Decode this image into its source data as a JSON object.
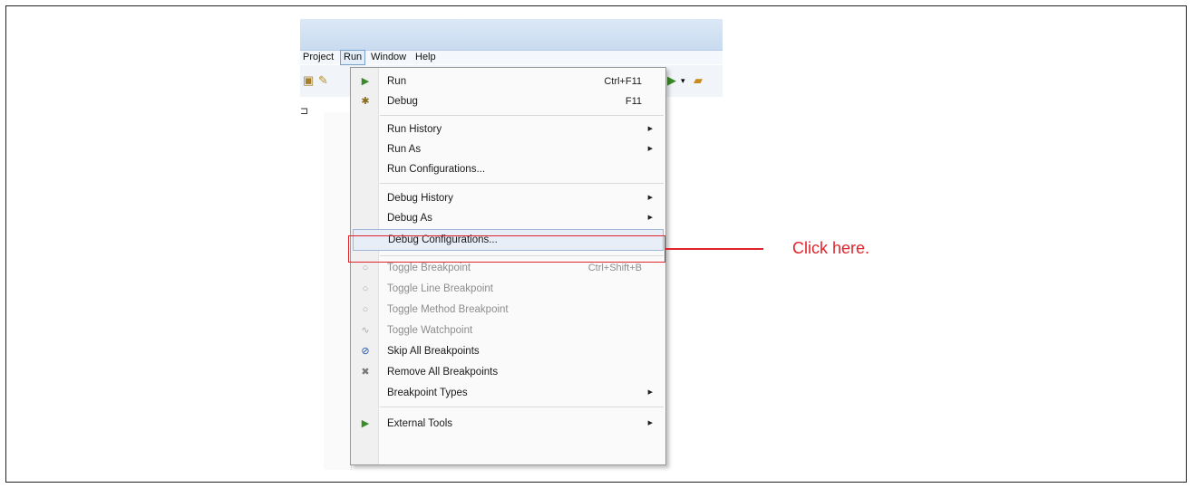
{
  "menubar": [
    {
      "label": "Project",
      "active": false
    },
    {
      "label": "Run",
      "active": true
    },
    {
      "label": "Window",
      "active": false
    },
    {
      "label": "Help",
      "active": false
    }
  ],
  "run_menu": {
    "items": [
      {
        "label": "Run",
        "accel": "Ctrl+F11",
        "icon": "run-icon",
        "glyph": "▶",
        "state": "enabled"
      },
      {
        "label": "Debug",
        "accel": "F11",
        "icon": "debug-icon",
        "glyph": "✱",
        "state": "enabled"
      },
      {
        "label": "Run History",
        "submenu": true,
        "state": "enabled"
      },
      {
        "label": "Run As",
        "submenu": true,
        "state": "enabled"
      },
      {
        "label": "Run Configurations...",
        "state": "enabled"
      },
      {
        "label": "Debug History",
        "submenu": true,
        "state": "enabled"
      },
      {
        "label": "Debug As",
        "submenu": true,
        "state": "enabled"
      },
      {
        "label": "Debug Configurations...",
        "state": "highlighted"
      },
      {
        "label": "Toggle Breakpoint",
        "accel": "Ctrl+Shift+B",
        "icon": "breakpoint-dot-icon",
        "glyph": "○",
        "state": "disabled"
      },
      {
        "label": "Toggle Line Breakpoint",
        "icon": "breakpoint-dot-icon",
        "glyph": "○",
        "state": "disabled"
      },
      {
        "label": "Toggle Method Breakpoint",
        "icon": "breakpoint-dot-icon",
        "glyph": "○",
        "state": "disabled"
      },
      {
        "label": "Toggle Watchpoint",
        "icon": "watchpoint-icon",
        "glyph": "∿",
        "state": "disabled"
      },
      {
        "label": "Skip All Breakpoints",
        "icon": "skip-breakpoints-icon",
        "glyph": "⊘",
        "state": "enabled"
      },
      {
        "label": "Remove All Breakpoints",
        "icon": "remove-breakpoints-icon",
        "glyph": "✖",
        "state": "enabled"
      },
      {
        "label": "Breakpoint Types",
        "submenu": true,
        "state": "enabled"
      },
      {
        "label": "External Tools",
        "submenu": true,
        "icon": "external-tools-icon",
        "glyph": "▶",
        "state": "enabled"
      }
    ]
  },
  "callout": {
    "text": "Click here.",
    "color": "#e0242c"
  }
}
